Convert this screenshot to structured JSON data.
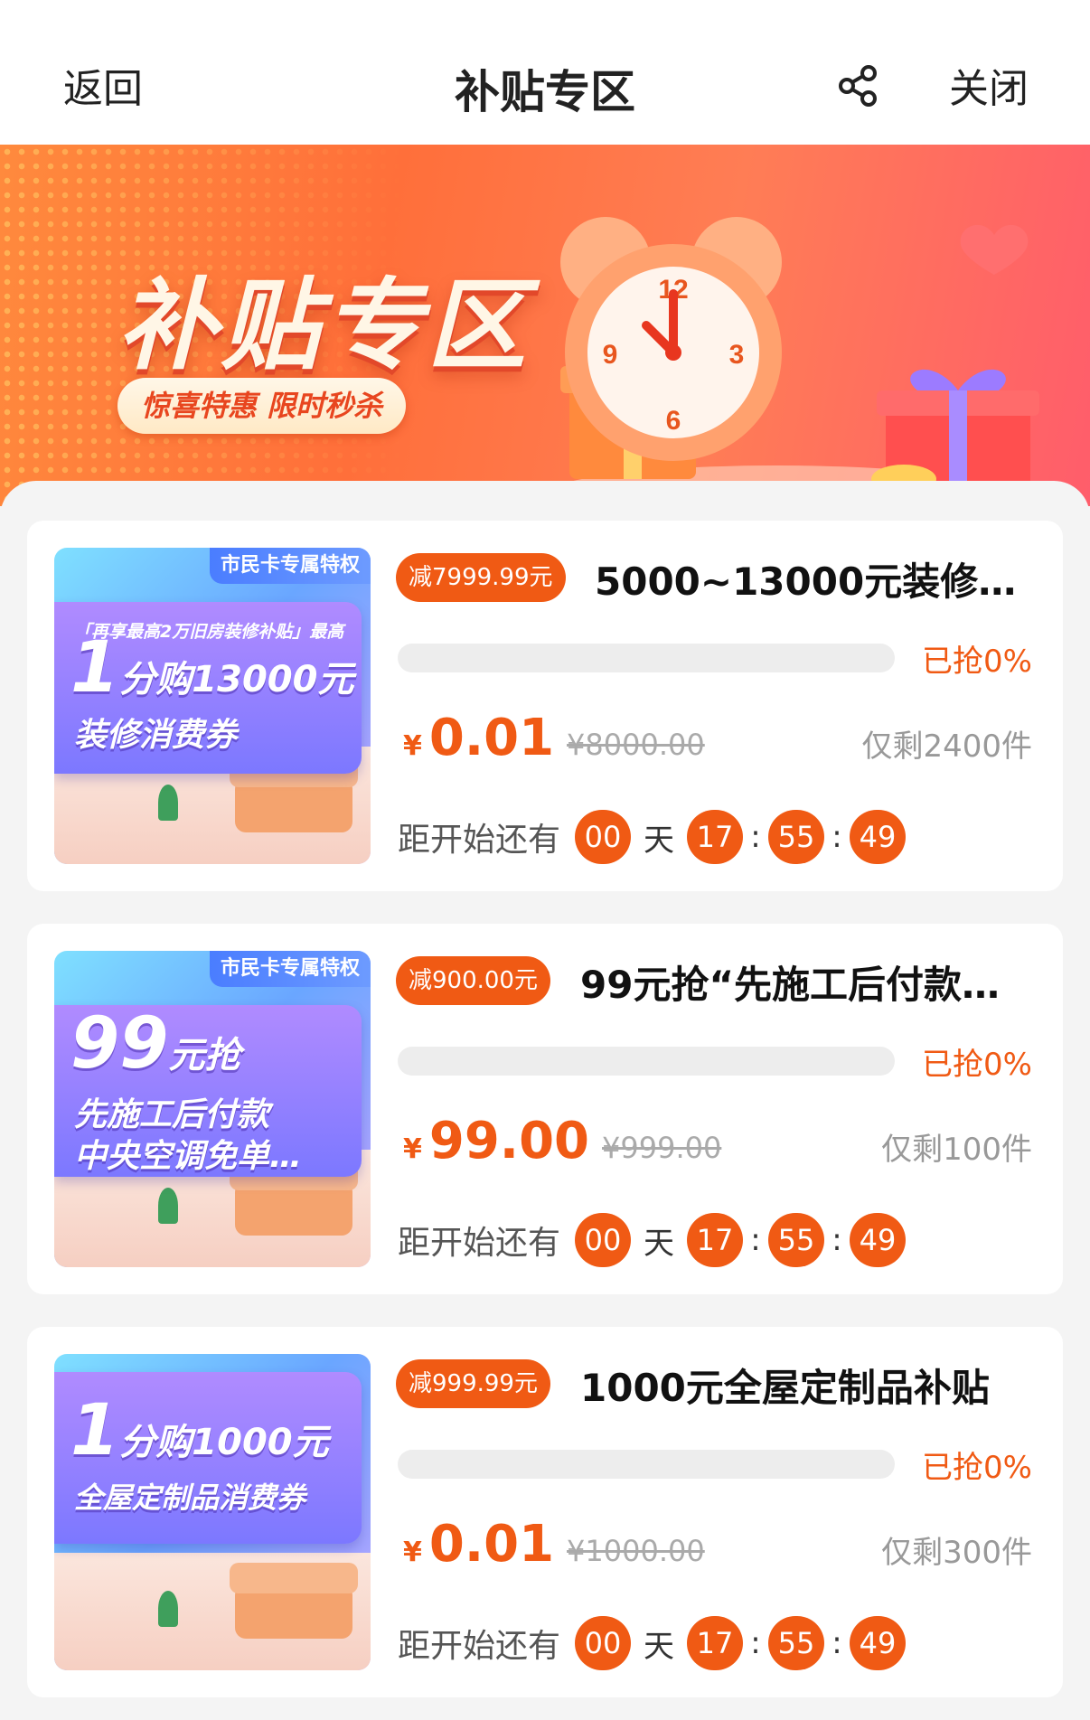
{
  "nav": {
    "back_label": "返回",
    "title": "补贴专区",
    "close_label": "关闭"
  },
  "banner": {
    "title": "补贴专区",
    "tagline": "惊喜特惠  限时秒杀"
  },
  "countdown_label": "距开始还有",
  "day_unit": "天",
  "colors": {
    "accent": "#f05a14",
    "banner_start": "#ff8a3d",
    "banner_end": "#ff5d6b"
  },
  "products": [
    {
      "discount": "减7999.99元",
      "title": "5000~13000元装修…",
      "grabbed": "已抢0%",
      "progress": 0,
      "price_symbol": "¥",
      "price": "0.01",
      "original_price": "¥8000.00",
      "remaining": "仅剩2400件",
      "countdown": {
        "days": "00",
        "hours": "17",
        "minutes": "55",
        "seconds": "49"
      },
      "thumb": {
        "badge": "市民卡专属特权",
        "line1": "「再享最高2万旧房装修补贴」最高",
        "big_number": "1",
        "big_text": "分购13000元",
        "line3": "装修消费券"
      }
    },
    {
      "discount": "减900.00元",
      "title": "99元抢“先施工后付款…",
      "grabbed": "已抢0%",
      "progress": 0,
      "price_symbol": "¥",
      "price": "99.00",
      "original_price": "¥999.00",
      "remaining": "仅剩100件",
      "countdown": {
        "days": "00",
        "hours": "17",
        "minutes": "55",
        "seconds": "49"
      },
      "thumb": {
        "badge": "市民卡专属特权",
        "line1": "",
        "big_number": "99",
        "big_text": "元抢",
        "line3": "先施工后付款",
        "line4": "中央空调免单…"
      }
    },
    {
      "discount": "减999.99元",
      "title": "1000元全屋定制品补贴",
      "grabbed": "已抢0%",
      "progress": 0,
      "price_symbol": "¥",
      "price": "0.01",
      "original_price": "¥1000.00",
      "remaining": "仅剩300件",
      "countdown": {
        "days": "00",
        "hours": "17",
        "minutes": "55",
        "seconds": "49"
      },
      "thumb": {
        "badge": "",
        "line1": "",
        "big_number": "1",
        "big_text": "分购1000元",
        "line3": "全屋定制品消费券"
      }
    }
  ]
}
